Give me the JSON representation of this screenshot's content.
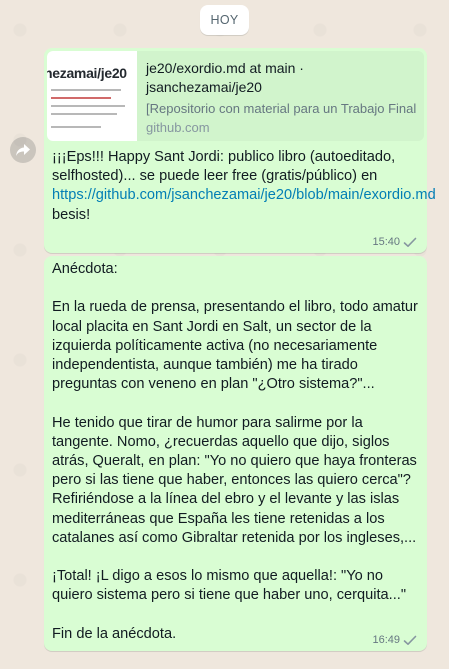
{
  "chat": {
    "date_divider": "HOY"
  },
  "messages": [
    {
      "link_preview": {
        "thumbnail_text": "hezamai/je20",
        "title": "je20/exordio.md at main · jsanchezamai/je20",
        "description": "[Repositorio con material para un Trabajo Final",
        "domain": "github.com"
      },
      "text_before_link": "¡¡¡Eps!!! Happy Sant Jordi: publico libro (autoeditado, selfhosted)... se puede leer free (gratis/público) en",
      "link": "https://github.com/jsanchezamai/je20/blob/main/exordio.md",
      "text_after_link": "besis!",
      "time": "15:40",
      "status_icon": "sent-check-icon"
    },
    {
      "paragraphs": [
        "Anécdota:",
        "En la rueda de prensa, presentando el libro, todo amatur local placita en Sant Jordi en Salt, un sector de la izquierda políticamente activa (no necesariamente independentista, aunque también) me ha tirado preguntas con veneno en plan \"¿Otro sistema?\"...",
        "He tenido que tirar de humor para salirme por la tangente. Nomo, ¿recuerdas aquello que dijo, siglos atrás, Queralt, en plan: \"Yo no quiero que haya fronteras pero si las tiene que haber, entonces las quiero cerca\"? Refiriéndose a la línea del ebro y el levante y las islas mediterráneas que España les tiene retenidas a los catalanes así como Gibraltar retenida por los ingleses,...",
        "¡Total! ¡L digo a esos lo mismo que aquella!: \"Yo no quiero sistema pero si tiene que haber uno, cerquita...\"",
        "Fin de la anécdota."
      ],
      "time": "16:49",
      "status_icon": "sent-check-icon"
    }
  ],
  "colors": {
    "outgoing_bubble": "#d9fdd3",
    "link_preview_bg": "#d1f4cc",
    "link": "#027eb5",
    "wallpaper": "#efe7dd"
  }
}
